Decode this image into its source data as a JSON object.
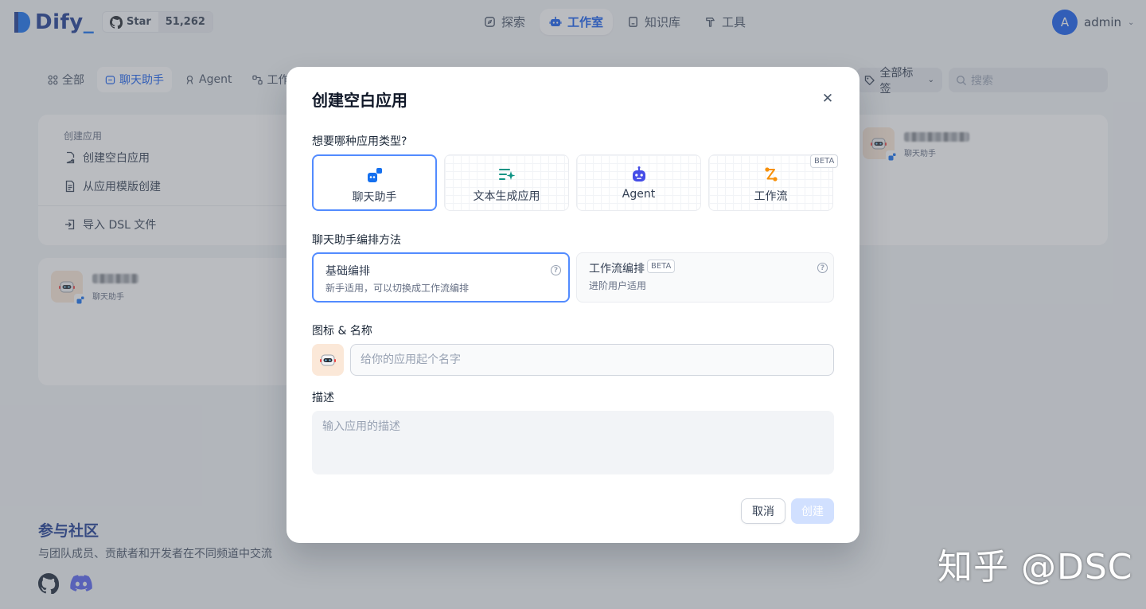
{
  "header": {
    "logo_text": "Dify",
    "github_star_label": "Star",
    "github_star_count": "51,262",
    "nav": [
      {
        "label": "探索",
        "icon": "compass-icon"
      },
      {
        "label": "工作室",
        "icon": "robot-icon"
      },
      {
        "label": "知识库",
        "icon": "book-icon"
      },
      {
        "label": "工具",
        "icon": "hammer-icon"
      }
    ],
    "active_nav": "工作室",
    "user_initial": "A",
    "user_name": "admin"
  },
  "tabs": [
    {
      "label": "全部"
    },
    {
      "label": "聊天助手"
    },
    {
      "label": "Agent"
    },
    {
      "label": "工作"
    }
  ],
  "active_tab": "聊天助手",
  "tag_filter": "全部标签",
  "search_placeholder": "搜索",
  "create_card": {
    "title": "创建应用",
    "blank_app": "创建空白应用",
    "from_template": "从应用模版创建",
    "import_dsl": "导入 DSL 文件"
  },
  "apps": [
    {
      "type": "聊天助手"
    },
    {
      "type": "聊天助手"
    }
  ],
  "community": {
    "title": "参与社区",
    "subtitle": "与团队成员、贡献者和开发者在不同频道中交流"
  },
  "watermark": "知乎 @DSC",
  "modal": {
    "title": "创建空白应用",
    "type_question": "想要哪种应用类型?",
    "app_types": [
      {
        "label": "聊天助手",
        "icon": "chat-bot-icon",
        "color": "#1570ef"
      },
      {
        "label": "文本生成应用",
        "icon": "text-generate-icon",
        "color": "#0e9384"
      },
      {
        "label": "Agent",
        "icon": "agent-robot-icon",
        "color": "#444ce7"
      },
      {
        "label": "工作流",
        "icon": "workflow-icon",
        "color": "#f79009",
        "badge": "BETA"
      }
    ],
    "selected_type": "聊天助手",
    "orchestration_label": "聊天助手编排方法",
    "modes": [
      {
        "title": "基础编排",
        "desc": "新手适用，可以切换成工作流编排"
      },
      {
        "title": "工作流编排",
        "badge": "BETA",
        "desc": "进阶用户适用"
      }
    ],
    "selected_mode": "基础编排",
    "icon_name_label": "图标 & 名称",
    "name_placeholder": "给你的应用起个名字",
    "desc_label": "描述",
    "desc_placeholder": "输入应用的描述",
    "cancel_label": "取消",
    "create_label": "创建"
  },
  "colors": {
    "accent": "#155eef",
    "brand_dark": "#1c3c93",
    "selected_border": "#528bff",
    "create_disabled": "#d1e0ff"
  }
}
